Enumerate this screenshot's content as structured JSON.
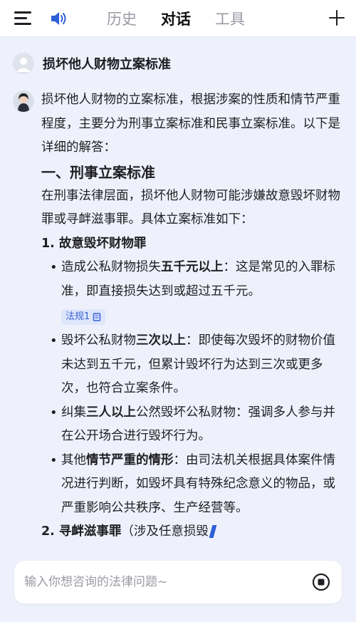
{
  "header": {
    "tabs": [
      {
        "label": "历史",
        "active": false
      },
      {
        "label": "对话",
        "active": true
      },
      {
        "label": "工具",
        "active": false
      }
    ],
    "icons": {
      "menu": "menu-icon",
      "speaker": "speaker-icon",
      "new": "plus-icon"
    },
    "accent_color": "#2f5fd7"
  },
  "user_message": {
    "text": "损坏他人财物立案标准"
  },
  "answer": {
    "intro": "损坏他人财物的立案标准，根据涉案的性质和情节严重程度，主要分为刑事立案标准和民事立案标准。以下是详细的解答：",
    "section1_title": "一、刑事立案标准",
    "section1_intro": "在刑事法律层面，损坏他人财物可能涉嫌故意毁坏财物罪或寻衅滋事罪。具体立案标准如下：",
    "item1_title": "1. 故意毁坏财物罪",
    "bullets": [
      {
        "pre": "造成公私财物损失",
        "bold": "五千元以上",
        "post": "：这是常见的入罪标准，即直接损失达到或超过五千元。"
      },
      {
        "pre": "毁坏公私财物",
        "bold": "三次以上",
        "post": "：即使每次毁坏的财物价值未达到五千元，但累计毁坏行为达到三次或更多次，也符合立案条件。"
      },
      {
        "pre": "纠集",
        "bold": "三人以上",
        "post": "公然毁坏公私财物：强调多人参与并在公开场合进行毁坏行为。"
      },
      {
        "pre": "其他",
        "bold": "情节严重的情形",
        "post": "：由司法机关根据具体案件情况进行判断，如毁坏具有特殊纪念意义的物品，或严重影响公共秩序、生产经营等。"
      }
    ],
    "law_chip": "法规1",
    "item2_title": "2. 寻衅滋事罪",
    "item2_tail": "（涉及任意损毁"
  },
  "input": {
    "placeholder": "输入你想咨询的法律问题~",
    "value": ""
  }
}
